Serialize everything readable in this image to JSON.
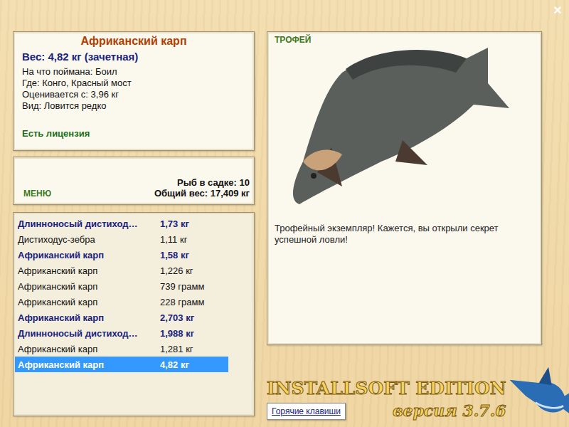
{
  "window": {
    "close": "×"
  },
  "fish_card": {
    "name": "Африканский карп",
    "weight": "Вес: 4,82 кг (зачетная)",
    "details": [
      "На что поймана: Боил",
      "Где: Конго, Красный мост",
      "Оценивается с: 3,96 кг",
      "Вид: Ловится редко"
    ],
    "license": "Есть лицензия"
  },
  "keepnet": {
    "menu": "МЕНЮ",
    "count": "Рыб в садке: 10",
    "total": "Общий вес: 17,409 кг"
  },
  "catch_list": [
    {
      "name": "Длинноносый дистиход…",
      "weight": "1,73 кг",
      "qualifying": true,
      "selected": false
    },
    {
      "name": "Дистиходус-зебра",
      "weight": "1,11 кг",
      "qualifying": false,
      "selected": false
    },
    {
      "name": "Африканский карп",
      "weight": "1,58 кг",
      "qualifying": true,
      "selected": false
    },
    {
      "name": "Африканский карп",
      "weight": "1,226 кг",
      "qualifying": false,
      "selected": false
    },
    {
      "name": "Африканский карп",
      "weight": "739 грамм",
      "qualifying": false,
      "selected": false
    },
    {
      "name": "Африканский карп",
      "weight": "228 грамм",
      "qualifying": false,
      "selected": false
    },
    {
      "name": "Африканский карп",
      "weight": "2,703 кг",
      "qualifying": true,
      "selected": false
    },
    {
      "name": "Длинноносый дистиход…",
      "weight": "1,988 кг",
      "qualifying": true,
      "selected": false
    },
    {
      "name": "Африканский карп",
      "weight": "1,281 кг",
      "qualifying": false,
      "selected": false
    },
    {
      "name": "Африканский карп",
      "weight": "4,82 кг",
      "qualifying": true,
      "selected": true
    }
  ],
  "trophy": {
    "label": "ТРОФЕЙ",
    "message": "Трофейный экземпляр! Кажется, вы открыли секрет успешной ловли!"
  },
  "logo": {
    "title": "INSTALLSOFT EDITION",
    "version": "версия 3.7.6"
  },
  "buttons": [
    "Горячие клавиши"
  ]
}
